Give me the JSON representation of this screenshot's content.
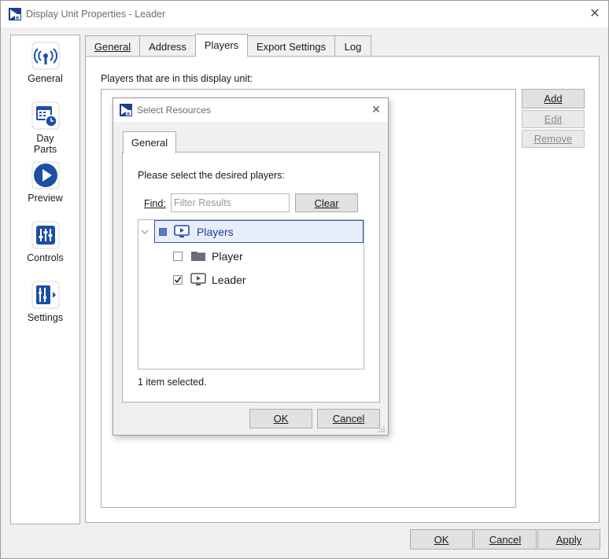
{
  "window": {
    "title": "Display Unit Properties - Leader"
  },
  "nav": {
    "items": [
      {
        "label": "General",
        "icon": "broadcast-icon"
      },
      {
        "label": "Day\nParts",
        "line1": "Day",
        "line2": "Parts",
        "icon": "calendar-clock-icon"
      },
      {
        "label": "Preview",
        "icon": "play-icon"
      },
      {
        "label": "Controls",
        "icon": "sliders-icon"
      },
      {
        "label": "Settings",
        "icon": "settings-panel-icon"
      }
    ]
  },
  "tabs": [
    {
      "label": "General",
      "active": false
    },
    {
      "label": "Address",
      "active": false
    },
    {
      "label": "Players",
      "active": true
    },
    {
      "label": "Export Settings",
      "active": false
    },
    {
      "label": "Log",
      "active": false
    }
  ],
  "players_tab": {
    "list_label": "Players that are in this display unit:",
    "buttons": {
      "add": "Add",
      "edit": "Edit",
      "remove": "Remove"
    }
  },
  "dialog": {
    "title": "Select Resources",
    "tab": "General",
    "prompt": "Please select the desired players:",
    "find_label": "Find:",
    "find_placeholder": "Filter Results",
    "clear_button": "Clear",
    "tree": {
      "root": {
        "label": "Players",
        "state": "partial"
      },
      "children": [
        {
          "label": "Player",
          "checked": false,
          "icon": "folder-icon"
        },
        {
          "label": "Leader",
          "checked": true,
          "icon": "player-monitor-icon"
        }
      ]
    },
    "status": "1 item selected.",
    "ok_button": "OK",
    "cancel_button": "Cancel"
  },
  "footer": {
    "ok": "OK",
    "cancel": "Cancel",
    "apply": "Apply"
  },
  "colors": {
    "accent": "#1b4fa3",
    "selection_border": "#2e5aa8",
    "selection_bg": "#e8eef9"
  }
}
